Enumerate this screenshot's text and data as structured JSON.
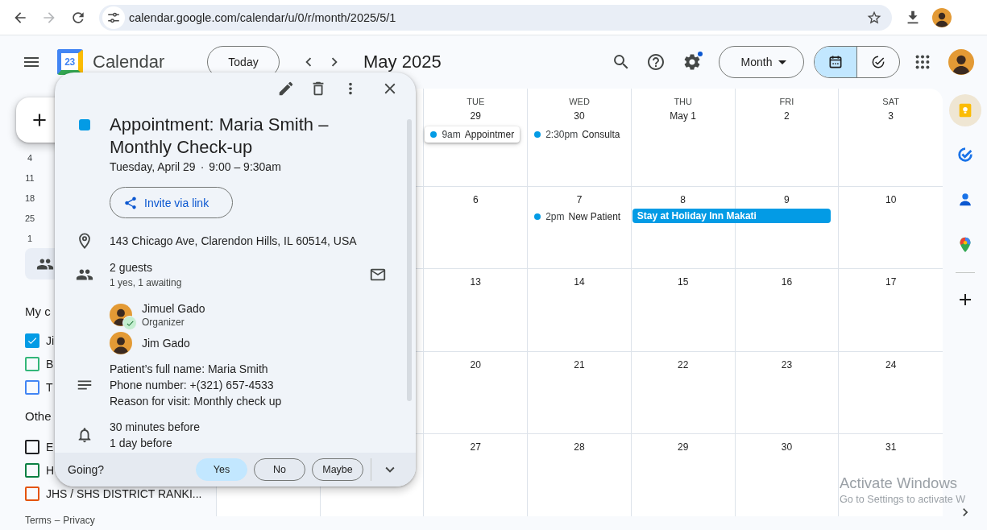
{
  "browser": {
    "url": "calendar.google.com/calendar/u/0/r/month/2025/5/1",
    "forward_disabled": true
  },
  "header": {
    "logo_day": "23",
    "app_name": "Calendar",
    "today_button": "Today",
    "period_title": "May 2025",
    "settings_badge": true,
    "view_dropdown": "Month",
    "view_toggle": [
      {
        "kind": "calendar",
        "selected": true
      },
      {
        "kind": "tasks",
        "selected": false
      }
    ]
  },
  "sidebar": {
    "mini_calendar_days": [
      "4",
      "11",
      "18",
      "25",
      "1"
    ],
    "my_calendars_heading": "My c",
    "my_calendars": [
      {
        "label": "Ji",
        "checked": true,
        "color": "#039be5"
      },
      {
        "label": "B",
        "checked": false,
        "color": "#33b679"
      },
      {
        "label": "T",
        "checked": false,
        "color": "#4285f4"
      }
    ],
    "other_calendars_heading": "Othe",
    "other_calendars": [
      {
        "label": "E",
        "checked": false,
        "color": "#202124"
      },
      {
        "label": "H",
        "checked": false,
        "color": "#0b8043"
      },
      {
        "label": "JHS / SHS DISTRICT RANKI...",
        "checked": false,
        "color": "#e4540e"
      }
    ],
    "terms_link": "Terms",
    "footer_separator": "–",
    "privacy_link": "Privacy"
  },
  "grid": {
    "weekday_headers": [
      "TUE",
      "WED",
      "THU",
      "FRI",
      "SAT"
    ],
    "weeks": [
      [
        {
          "date": "29",
          "events": [
            {
              "kind": "timed",
              "time": "9am",
              "title": "Appointmer",
              "color": "#039be5",
              "selected": true
            }
          ]
        },
        {
          "date": "30",
          "events": [
            {
              "kind": "timed",
              "time": "2:30pm",
              "title": "Consulta",
              "color": "#039be5",
              "selected": false
            }
          ]
        },
        {
          "date": "May 1"
        },
        {
          "date": "2"
        },
        {
          "date": "3"
        }
      ],
      [
        {
          "date": "6"
        },
        {
          "date": "7",
          "events": [
            {
              "kind": "timed",
              "time": "2pm",
              "title": "New Patient",
              "color": "#039be5",
              "selected": false
            }
          ]
        },
        {
          "date": "8",
          "events": [
            {
              "kind": "allday",
              "title": "Stay at Holiday Inn Makati",
              "color": "#039be5",
              "selected": false
            }
          ]
        },
        {
          "date": "9"
        },
        {
          "date": "10"
        }
      ],
      [
        {
          "date": "13"
        },
        {
          "date": "14"
        },
        {
          "date": "15"
        },
        {
          "date": "16"
        },
        {
          "date": "17"
        }
      ],
      [
        {
          "date": "20"
        },
        {
          "date": "21"
        },
        {
          "date": "22"
        },
        {
          "date": "23"
        },
        {
          "date": "24"
        }
      ],
      [
        {
          "date": "27"
        },
        {
          "date": "28"
        },
        {
          "date": "29"
        },
        {
          "date": "30"
        },
        {
          "date": "31"
        }
      ]
    ]
  },
  "event_popup": {
    "color": "#039be5",
    "title": "Appointment: Maria Smith – Monthly Check-up",
    "date": "Tuesday, April 29",
    "separator": "·",
    "time": "9:00 – 9:30am",
    "invite_button": "Invite via link",
    "location": "143 Chicago Ave, Clarendon Hills, IL 60514, USA",
    "guests_count": "2 guests",
    "guests_summary": "1 yes, 1 awaiting",
    "guests": [
      {
        "name": "Jimuel Gado",
        "role": "Organizer",
        "accepted": true
      },
      {
        "name": "Jim Gado",
        "accepted": false
      }
    ],
    "description": [
      "Patient’s full name: Maria Smith",
      "Phone number: +(321) 657-4533",
      "Reason for visit: Monthly check up"
    ],
    "reminders": [
      "30 minutes before",
      "1 day before"
    ],
    "rsvp_label": "Going?",
    "rsvp_options": [
      {
        "label": "Yes",
        "selected": true
      },
      {
        "label": "No",
        "selected": false
      },
      {
        "label": "Maybe",
        "selected": false
      }
    ]
  },
  "os_notice": {
    "title": "Activate Windows",
    "text": "Go to Settings to activate W"
  }
}
